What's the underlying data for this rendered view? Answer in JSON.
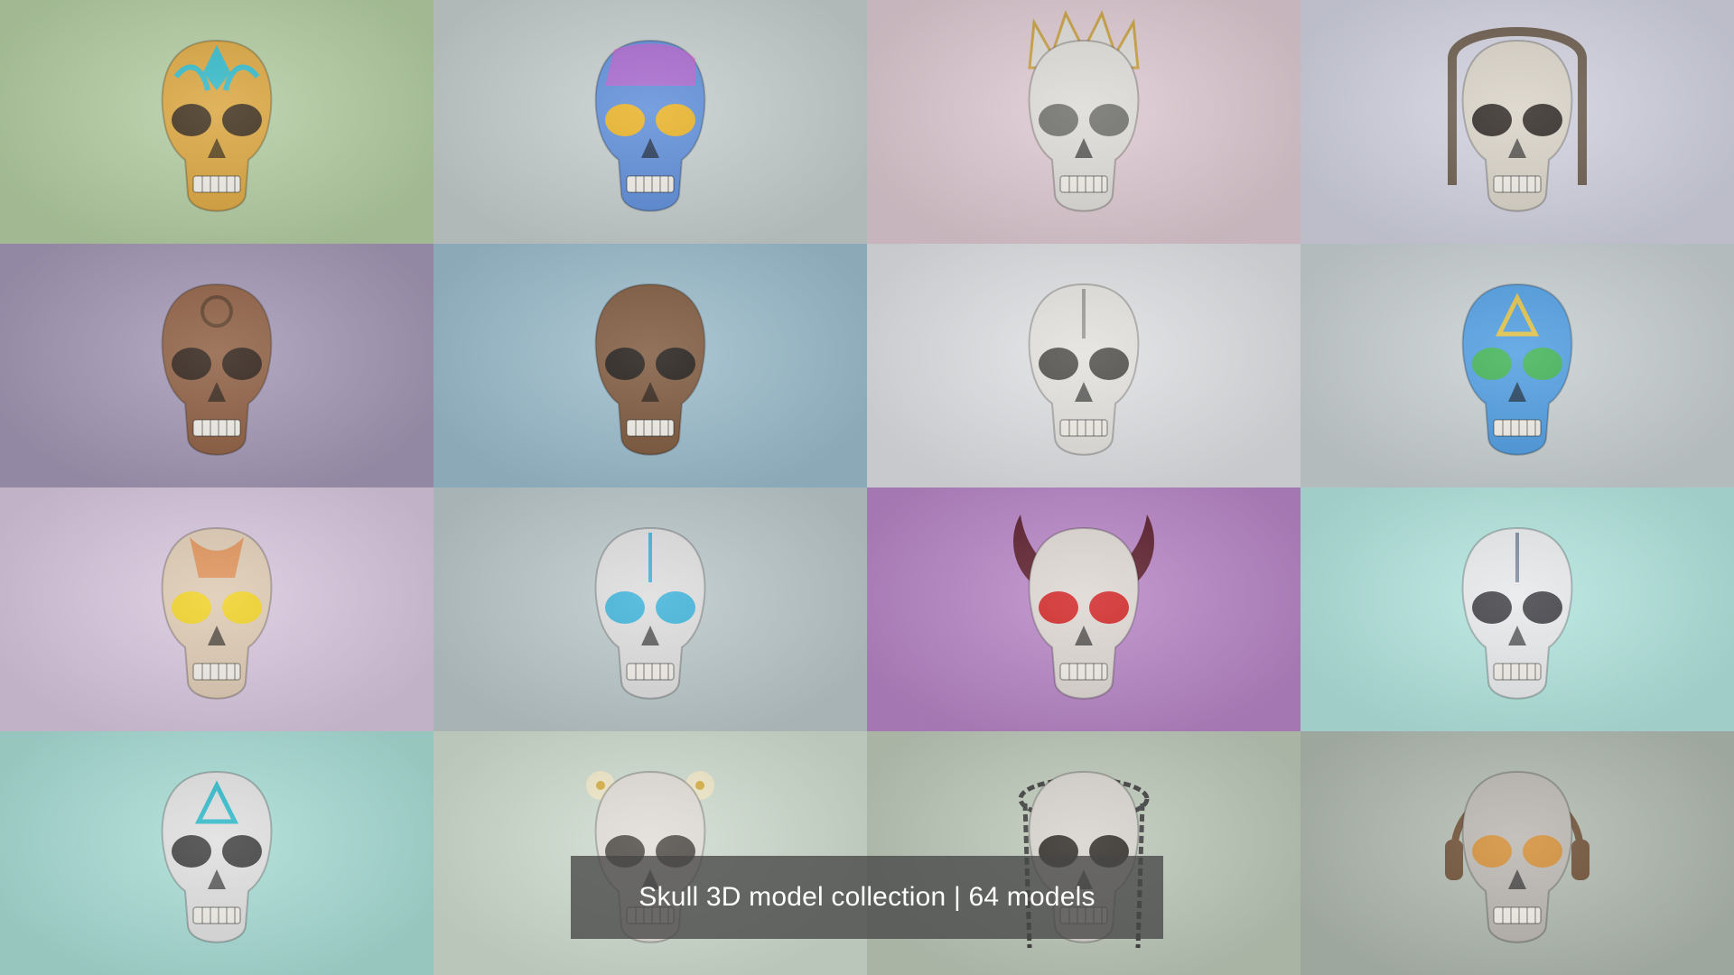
{
  "caption": {
    "text": "Skull 3D model collection | 64 models"
  },
  "tiles": [
    {
      "name": "skull-tile-aztec-gold",
      "bg": "#b3cda2",
      "skull": "#d9a33a",
      "accent": "#2fb8c9",
      "eye": "#3a2a14"
    },
    {
      "name": "skull-tile-iridescent",
      "bg": "#c4cdcd",
      "skull": "#5a8bd8",
      "accent": "#d84fc8",
      "eye": "#e8b020"
    },
    {
      "name": "skull-tile-crowned",
      "bg": "#ddc9d1",
      "skull": "#dcdad6",
      "accent": "#c8a040",
      "eye": "#6a6a66"
    },
    {
      "name": "skull-tile-ornate-frame",
      "bg": "#d1d2e0",
      "skull": "#d8d2c6",
      "accent": "#6a5a4a",
      "eye": "#2a2420"
    },
    {
      "name": "skull-tile-carved-wood",
      "bg": "#a397b5",
      "skull": "#8a5a3c",
      "accent": "#5a3a24",
      "eye": "#2a1a10"
    },
    {
      "name": "skull-tile-rusted-metal",
      "bg": "#9bbccc",
      "skull": "#7a5438",
      "accent": "#4a3020",
      "eye": "#1a1410"
    },
    {
      "name": "skull-tile-cracked-white",
      "bg": "#dfe0e3",
      "skull": "#e2e0dc",
      "accent": "#9a9894",
      "eye": "#4a4844"
    },
    {
      "name": "skull-tile-blue-rune",
      "bg": "#c8d0d2",
      "skull": "#4a9ae0",
      "accent": "#e0c040",
      "eye": "#3ab050"
    },
    {
      "name": "skull-tile-orange-cracked",
      "bg": "#d8c6de",
      "skull": "#dcc8b0",
      "accent": "#e07830",
      "eye": "#f0d020"
    },
    {
      "name": "skull-tile-cyber-blue-eyes",
      "bg": "#bac7c9",
      "skull": "#dcdcdc",
      "accent": "#3ab0d8",
      "eye": "#3ab0d8"
    },
    {
      "name": "skull-tile-horned-demon",
      "bg": "#b785c6",
      "skull": "#ddd6d2",
      "accent": "#5a1a2a",
      "eye": "#d02020"
    },
    {
      "name": "skull-tile-stitched",
      "bg": "#b2e4de",
      "skull": "#e6e8ea",
      "accent": "#7a8aa0",
      "eye": "#3a3a40"
    },
    {
      "name": "skull-tile-tech-triangle",
      "bg": "#a8dcd5",
      "skull": "#dedede",
      "accent": "#2ab8c8",
      "eye": "#3a3a3a"
    },
    {
      "name": "skull-tile-flower-crown",
      "bg": "#cfdccf",
      "skull": "#e0dcd6",
      "accent": "#f0e8c8",
      "eye": "#4a4642"
    },
    {
      "name": "skull-tile-chained",
      "bg": "#bcc8b8",
      "skull": "#d6d2cc",
      "accent": "#3a3a3a",
      "eye": "#2a2622"
    },
    {
      "name": "skull-tile-headphones",
      "bg": "#b0bab0",
      "skull": "#b8b4ae",
      "accent": "#6a4a30",
      "eye": "#d08a30"
    }
  ]
}
